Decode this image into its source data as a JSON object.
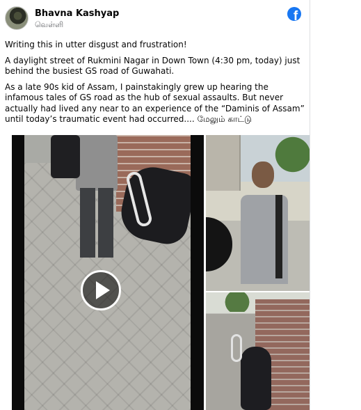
{
  "post": {
    "author": "Bhavna Kashyap",
    "subtitle": "வெள்ளி",
    "paragraphs": [
      "Writing this in utter disgust and frustration!",
      "A daylight street of Rukmini Nagar in Down Town (4:30 pm, today) just behind the busiest GS road of Guwahati.",
      "As a late 90s kid of Assam, I painstakingly grew up hearing the infamous tales of GS road as the hub of sexual assaults. But never actually had lived any near to an experience of the “Daminis of Assam” until today’s traumatic event had occurred...."
    ],
    "see_more": "மேலும் காட்டு"
  },
  "icons": {
    "brand": "facebook-icon",
    "play": "play-icon"
  },
  "colors": {
    "facebook_blue": "#1877f2",
    "text": "#050505",
    "secondary_text": "#65676b"
  }
}
